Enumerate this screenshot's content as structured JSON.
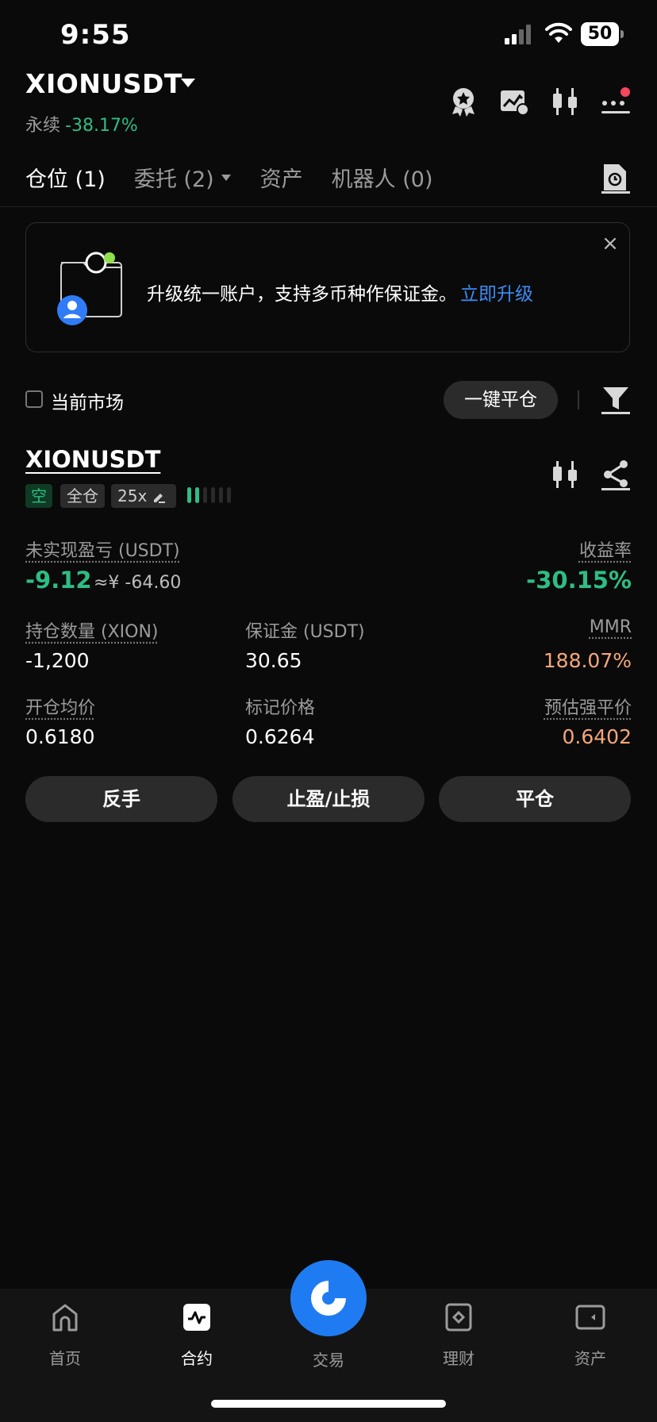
{
  "status": {
    "time": "9:55",
    "battery": "50"
  },
  "header": {
    "symbol": "XIONUSDT",
    "contract_type": "永续",
    "change": "-38.17%"
  },
  "tabs": [
    {
      "label": "仓位 (1)"
    },
    {
      "label": "委托 (2)"
    },
    {
      "label": "资产"
    },
    {
      "label": "机器人 (0)"
    }
  ],
  "banner": {
    "text": "升级统一账户，支持多币种作保证金。",
    "link": "立即升级",
    "close": "×"
  },
  "filter": {
    "current_market": "当前市场",
    "close_all": "一键平仓"
  },
  "position": {
    "symbol": "XIONUSDT",
    "side": "空",
    "margin_mode": "全仓",
    "leverage": "25x",
    "risk_level": 2,
    "risk_bars": 6,
    "pnl_label": "未实现盈亏 (USDT)",
    "pnl_value": "-9.12",
    "pnl_cny": "≈¥ -64.60",
    "roe_label": "收益率",
    "roe_value": "-30.15%",
    "qty_label": "持仓数量 (XION)",
    "qty_value": "-1,200",
    "margin_label": "保证金 (USDT)",
    "margin_value": "30.65",
    "mmr_label": "MMR",
    "mmr_value": "188.07%",
    "entry_label": "开仓均价",
    "entry_value": "0.6180",
    "mark_label": "标记价格",
    "mark_value": "0.6264",
    "liq_label": "预估强平价",
    "liq_value": "0.6402"
  },
  "actions": {
    "reverse": "反手",
    "tpsl": "止盈/止损",
    "close": "平仓"
  },
  "nav": [
    {
      "label": "首页",
      "icon": "home-icon"
    },
    {
      "label": "合约",
      "icon": "futures-icon"
    },
    {
      "label": "交易",
      "icon": "trade-icon"
    },
    {
      "label": "理财",
      "icon": "earn-icon"
    },
    {
      "label": "资产",
      "icon": "wallet-icon"
    }
  ],
  "colors": {
    "green": "#2ebd85",
    "orange": "#f4a77a",
    "blue": "#1f7bf2",
    "red": "#f6465d"
  }
}
